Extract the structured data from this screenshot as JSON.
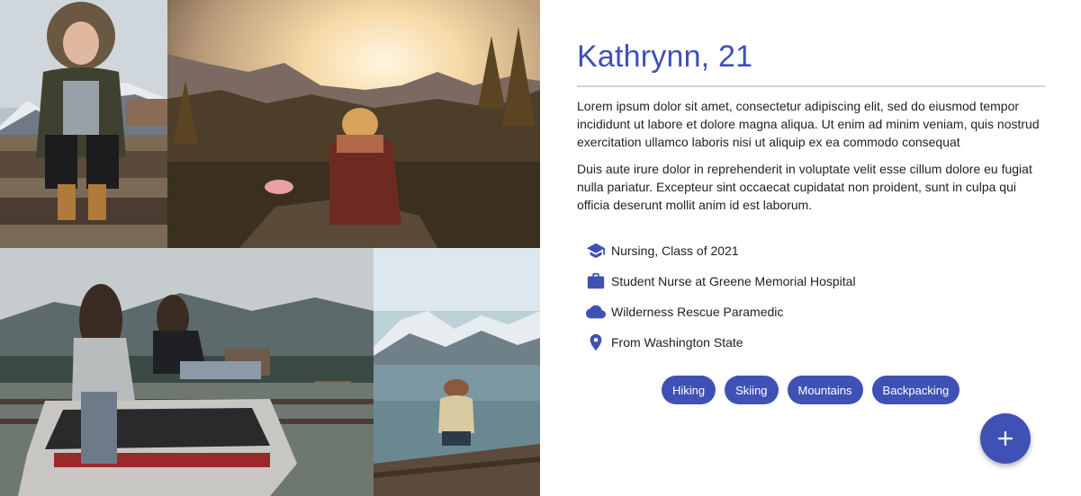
{
  "profile": {
    "name": "Kathrynn, 21",
    "paragraphs": [
      "Lorem ipsum dolor sit amet, consectetur adipiscing elit, sed do eiusmod tempor incididunt ut labore et dolore magna aliqua. Ut enim ad minim veniam, quis nostrud exercitation ullamco laboris nisi ut aliquip ex ea commodo consequat",
      "Duis aute irure dolor in reprehenderit in voluptate velit esse cillum dolore eu fugiat nulla pariatur. Excepteur sint occaecat cupidatat non proident, sunt in culpa qui officia deserunt mollit anim id est laborum."
    ],
    "facts": [
      {
        "icon": "graduation-cap-icon",
        "text": "Nursing, Class of 2021"
      },
      {
        "icon": "briefcase-icon",
        "text": "Student Nurse at Greene Memorial Hospital"
      },
      {
        "icon": "cloud-icon",
        "text": "Wilderness Rescue Paramedic"
      },
      {
        "icon": "location-pin-icon",
        "text": "From Washington State"
      }
    ],
    "tags": [
      "Hiking",
      "Skiing",
      "Mountains",
      "Backpacking"
    ]
  },
  "fab": {
    "icon": "plus-icon"
  },
  "colors": {
    "accent": "#3f51b5",
    "divider": "#d4d4d4",
    "text": "#222222"
  }
}
